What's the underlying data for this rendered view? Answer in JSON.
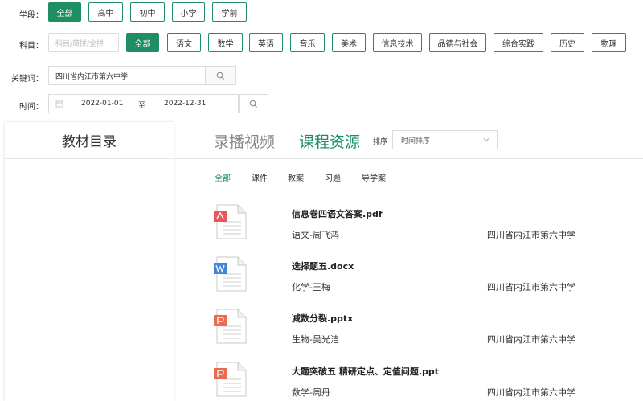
{
  "filters": {
    "stage": {
      "label": "学段：",
      "options": [
        "全部",
        "高中",
        "初中",
        "小学",
        "学前"
      ],
      "active": 0
    },
    "subject": {
      "label": "科目：",
      "search_placeholder": "科目/简拼/全拼",
      "options": [
        "全部",
        "语文",
        "数学",
        "英语",
        "音乐",
        "美术",
        "信息技术",
        "品德与社会",
        "综合实践",
        "历史",
        "物理"
      ],
      "active": 0
    },
    "keyword": {
      "label": "关键词：",
      "value": "四川省内江市第六中学"
    },
    "time": {
      "label": "时间：",
      "start": "2022-01-01",
      "separator": "至",
      "end": "2022-12-31"
    }
  },
  "sidebar": {
    "title": "教材目录"
  },
  "main": {
    "tabs": [
      "录播视频",
      "课程资源"
    ],
    "active_tab": 1,
    "sort": {
      "label": "排序",
      "value": "时间排序"
    },
    "sub_tabs": [
      "全部",
      "课件",
      "教案",
      "习题",
      "导学案"
    ],
    "active_sub_tab": 0,
    "files": [
      {
        "name": "信息卷四语文答案.pdf",
        "author": "语文-周飞鸿",
        "school": "四川省内江市第六中学",
        "icon": "pdf-file-icon",
        "badge_color": "#e8575f"
      },
      {
        "name": "选择题五.docx",
        "author": "化学-王梅",
        "school": "四川省内江市第六中学",
        "icon": "word-file-icon",
        "badge_color": "#3d87d6"
      },
      {
        "name": "减数分裂.pptx",
        "author": "生物-吴光洁",
        "school": "四川省内江市第六中学",
        "icon": "ppt-file-icon",
        "badge_color": "#ea6b4e"
      },
      {
        "name": "大题突破五 精研定点、定值问题.ppt",
        "author": "数学-周丹",
        "school": "四川省内江市第六中学",
        "icon": "ppt-file-icon",
        "badge_color": "#ea6b4e"
      }
    ]
  },
  "colors": {
    "accent": "#1f8f63",
    "inactive_tab": "#888888"
  }
}
